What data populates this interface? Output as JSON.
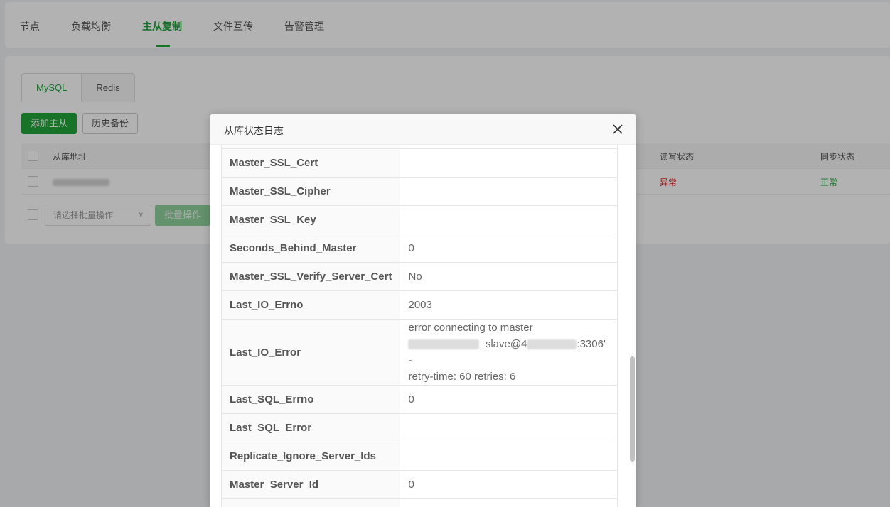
{
  "nav": {
    "tabs": [
      "节点",
      "负载均衡",
      "主从复制",
      "文件互传",
      "告警管理"
    ],
    "active_index": 2
  },
  "subtabs": [
    "MySQL",
    "Redis"
  ],
  "buttons": {
    "add_master_slave": "添加主从",
    "history_backup": "历史备份",
    "batch_action": "批量操作"
  },
  "table": {
    "headers": {
      "slave_address": "从库地址",
      "rw_status": "读写状态",
      "sync_status": "同步状态"
    },
    "row": {
      "rw_status": "异常",
      "sync_status": "正常"
    }
  },
  "batch_select": {
    "placeholder": "请选择批量操作"
  },
  "modal": {
    "title": "从库状态日志",
    "rows": [
      {
        "key": "",
        "value": ""
      },
      {
        "key": "Master_SSL_Cert",
        "value": ""
      },
      {
        "key": "Master_SSL_Cipher",
        "value": ""
      },
      {
        "key": "Master_SSL_Key",
        "value": ""
      },
      {
        "key": "Seconds_Behind_Master",
        "value": "0"
      },
      {
        "key": "Master_SSL_Verify_Server_Cert",
        "value": "No"
      },
      {
        "key": "Last_IO_Errno",
        "value": "2003"
      },
      {
        "key": "Last_IO_Error",
        "value": ""
      },
      {
        "key": "Last_SQL_Errno",
        "value": "0"
      },
      {
        "key": "Last_SQL_Error",
        "value": ""
      },
      {
        "key": "Replicate_Ignore_Server_Ids",
        "value": ""
      },
      {
        "key": "Master_Server_Id",
        "value": "0"
      },
      {
        "key": "",
        "value": ""
      }
    ],
    "io_error": {
      "line1": "error connecting to master",
      "line2_mid": "_slave@4",
      "line2_end": ":3306' -",
      "line3": "retry-time: 60 retries: 6"
    }
  },
  "colors": {
    "accent": "#20a53a",
    "error": "#e02020"
  },
  "icons": {
    "close": "close-icon",
    "dropdown": "chevron-down-icon"
  }
}
